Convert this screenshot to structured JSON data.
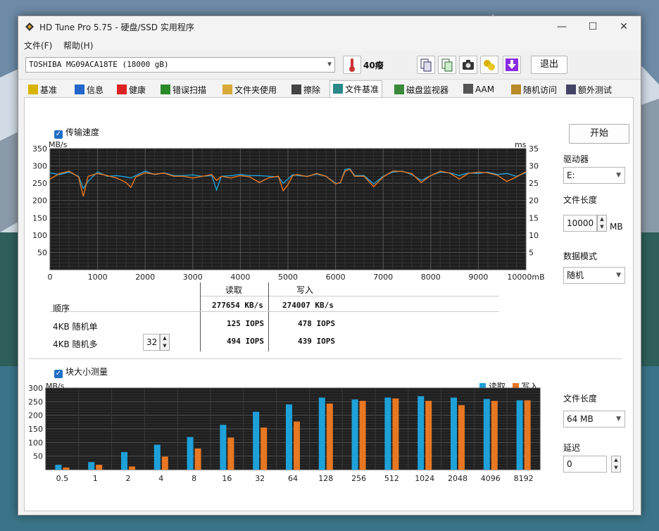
{
  "window": {
    "title": "HD Tune Pro 5.75 - 硬盘/SSD 实用程序",
    "minimize": "—",
    "maximize": "☐",
    "close": "✕"
  },
  "menu": {
    "file": "文件(F)",
    "help": "帮助(H)"
  },
  "toolbar": {
    "drive": "TOSHIBA MG09ACA18TE (18000 gB)",
    "temperature": "40癈",
    "exit_label": "退出",
    "icons": [
      "copy-info-icon",
      "copy-screen-icon",
      "camera-icon",
      "options-icon",
      "download-icon"
    ]
  },
  "tabs": [
    "基准",
    "信息",
    "健康",
    "错误扫描",
    "文件夹使用",
    "擦除",
    "文件基准",
    "磁盘监视器",
    "AAM",
    "随机访问",
    "额外测试"
  ],
  "active_tab": "文件基准",
  "transfer": {
    "checkbox_label": "传输速度",
    "unit_left": "MB/s",
    "unit_right": "ms",
    "y_ticks_left": [
      "350",
      "300",
      "250",
      "200",
      "150",
      "100",
      "50"
    ],
    "y_ticks_right": [
      "35",
      "30",
      "25",
      "20",
      "15",
      "10",
      "5"
    ],
    "x_ticks": [
      "0",
      "1000",
      "2000",
      "3000",
      "4000",
      "5000",
      "6000",
      "7000",
      "8000",
      "9000",
      "10000mB"
    ]
  },
  "results": {
    "col_read": "读取",
    "col_write": "写入",
    "rows": [
      {
        "label": "顺序",
        "read": "277654 KB/s",
        "write": "274007 KB/s"
      },
      {
        "label": "4KB 随机单",
        "read": "125 IOPS",
        "write": "478 IOPS"
      },
      {
        "label": "4KB 随机多",
        "read": "494 IOPS",
        "write": "439 IOPS"
      }
    ],
    "queue_depth": "32"
  },
  "block": {
    "checkbox_label": "块大小测量",
    "unit": "MB/s",
    "legend_read": "读取",
    "legend_write": "写入",
    "y_ticks": [
      "300",
      "250",
      "200",
      "150",
      "100",
      "50"
    ]
  },
  "right_panel": {
    "start": "开始",
    "drive_label": "驱动器",
    "drive_value": "E:",
    "file_len_label": "文件长度",
    "file_len_value": "10000",
    "file_len_unit": "MB",
    "data_mode_label": "数据模式",
    "data_mode_value": "随机",
    "file_len2_label": "文件长度",
    "file_len2_value": "64 MB",
    "delay_label": "延迟",
    "delay_value": "0"
  },
  "chart_data": [
    {
      "type": "line",
      "title": "传输速度",
      "xlabel": "",
      "ylabel": "MB/s",
      "xlim": [
        0,
        10000
      ],
      "ylim": [
        0,
        350
      ],
      "x": [
        0,
        200,
        400,
        600,
        700,
        800,
        1000,
        1200,
        1400,
        1600,
        1700,
        1800,
        2000,
        2200,
        2400,
        2600,
        2800,
        3000,
        3200,
        3400,
        3500,
        3600,
        3800,
        4000,
        4200,
        4400,
        4600,
        4800,
        4900,
        5000,
        5100,
        5200,
        5400,
        5600,
        5800,
        6000,
        6100,
        6200,
        6300,
        6400,
        6600,
        6800,
        7000,
        7200,
        7400,
        7600,
        7800,
        8000,
        8200,
        8400,
        8600,
        8800,
        9000,
        9200,
        9400,
        9600,
        9800,
        10000
      ],
      "series": [
        {
          "name": "读取",
          "color": "#1da1d8",
          "values": [
            280,
            275,
            282,
            270,
            235,
            255,
            283,
            270,
            272,
            268,
            265,
            272,
            285,
            275,
            280,
            272,
            272,
            274,
            270,
            272,
            230,
            270,
            272,
            275,
            272,
            272,
            270,
            268,
            250,
            262,
            275,
            272,
            270,
            276,
            270,
            250,
            250,
            290,
            292,
            272,
            272,
            248,
            270,
            282,
            285,
            275,
            258,
            272,
            282,
            280,
            272,
            280,
            278,
            282,
            275,
            278,
            270,
            280
          ]
        },
        {
          "name": "写入",
          "color": "#e87722",
          "values": [
            262,
            278,
            285,
            268,
            212,
            270,
            278,
            272,
            265,
            252,
            238,
            268,
            280,
            276,
            279,
            270,
            270,
            265,
            270,
            275,
            258,
            270,
            265,
            272,
            268,
            252,
            266,
            270,
            228,
            246,
            272,
            275,
            269,
            278,
            270,
            248,
            252,
            285,
            290,
            270,
            270,
            240,
            268,
            285,
            284,
            278,
            252,
            272,
            285,
            279,
            262,
            279,
            282,
            280,
            273,
            255,
            268,
            283
          ]
        }
      ]
    },
    {
      "type": "bar",
      "title": "块大小测量",
      "xlabel": "",
      "ylabel": "MB/s",
      "ylim": [
        0,
        300
      ],
      "categories": [
        "0.5",
        "1",
        "2",
        "4",
        "8",
        "16",
        "32",
        "64",
        "128",
        "256",
        "512",
        "1024",
        "2048",
        "4096",
        "8192"
      ],
      "series": [
        {
          "name": "读取",
          "color": "#1da1d8",
          "values": [
            18,
            28,
            65,
            92,
            120,
            165,
            213,
            240,
            265,
            258,
            265,
            270,
            265,
            260,
            255
          ]
        },
        {
          "name": "写入",
          "color": "#e87722",
          "values": [
            8,
            18,
            12,
            48,
            78,
            118,
            155,
            177,
            243,
            253,
            262,
            253,
            237,
            253,
            255
          ]
        }
      ]
    }
  ]
}
